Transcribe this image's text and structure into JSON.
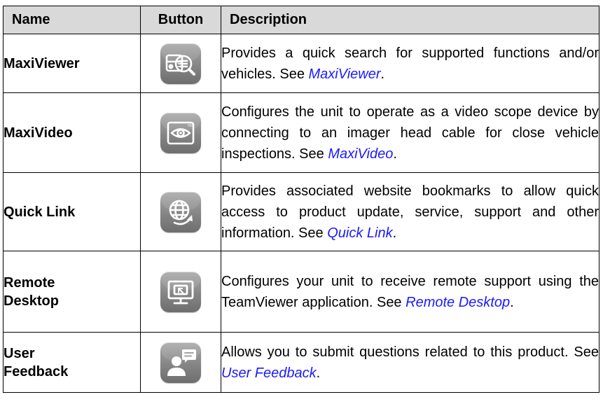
{
  "headers": {
    "name": "Name",
    "button": "Button",
    "description": "Description"
  },
  "rows": [
    {
      "name": "MaxiViewer",
      "icon": "maxiviewer-icon",
      "desc": "Provides a quick search for supported functions and/or vehicles. See ",
      "link": "MaxiViewer",
      "end": "."
    },
    {
      "name": "MaxiVideo",
      "icon": "maxivideo-icon",
      "desc": "Configures the unit to operate as a video scope device by connecting to an imager head cable for close vehicle inspections. See ",
      "link": "MaxiVideo",
      "end": "."
    },
    {
      "name": "Quick Link",
      "icon": "quick-link-icon",
      "desc": "Provides associated website bookmarks to allow quick access to product update, service, support and other information. See ",
      "link": "Quick Link",
      "end": "."
    },
    {
      "name_line1": "Remote",
      "name_line2": "Desktop",
      "icon": "remote-desktop-icon",
      "desc": "Configures your unit to receive remote support using the TeamViewer application. See ",
      "link": "Remote Desktop",
      "end": "."
    },
    {
      "name_line1": "User",
      "name_line2": "Feedback",
      "icon": "user-feedback-icon",
      "desc": "Allows you to submit questions related to this product. See ",
      "link": "User Feedback",
      "end": "."
    }
  ],
  "colors": {
    "header_bg": "#d9d9d9",
    "link": "#1a1aff",
    "icon_gray": "#858585"
  }
}
